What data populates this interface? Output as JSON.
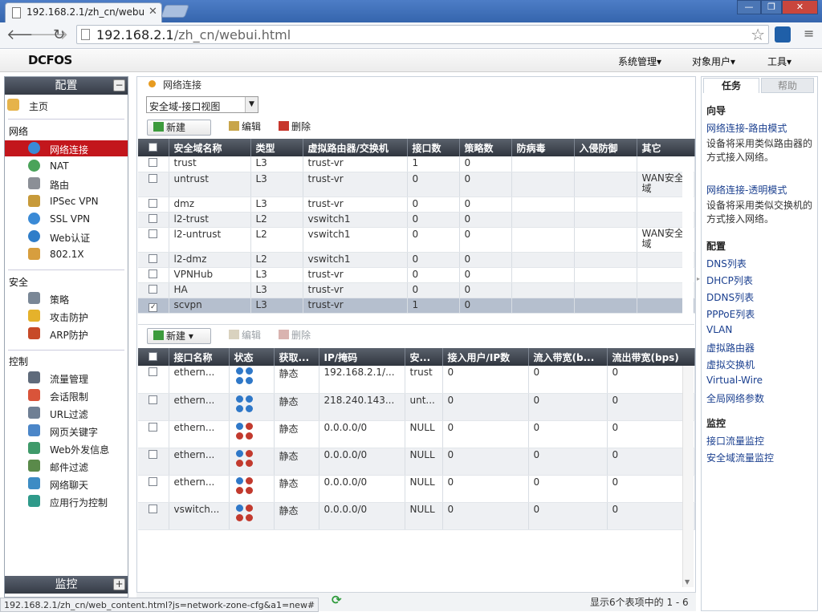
{
  "browser": {
    "tab_title": "192.168.2.1/zh_cn/webu",
    "url_host": "192.168.2.1",
    "url_path": "/zh_cn/webui.html",
    "status_url": "192.168.2.1/zh_cn/web_content.html?js=network-zone-cfg&a1=new#"
  },
  "app": {
    "logo": "DCFOS",
    "menus": [
      "系统管理",
      "对象用户",
      "工具"
    ]
  },
  "sidebar": {
    "config_title": "配置",
    "monitor_title": "监控",
    "home": "主页",
    "groups": {
      "network": "网络",
      "security": "安全",
      "control": "控制"
    },
    "network_items": [
      "网络连接",
      "NAT",
      "路由",
      "IPSec VPN",
      "SSL VPN",
      "Web认证",
      "802.1X"
    ],
    "security_items": [
      "策略",
      "攻击防护",
      "ARP防护"
    ],
    "control_items": [
      "流量管理",
      "会话限制",
      "URL过滤",
      "网页关键字",
      "Web外发信息",
      "邮件过滤",
      "网络聊天",
      "应用行为控制"
    ],
    "selected": "网络连接"
  },
  "main": {
    "breadcrumb": "网络连接",
    "view_select": "安全域-接口视图",
    "zone_toolbar": {
      "new": "新建",
      "edit": "编辑",
      "delete": "删除"
    },
    "zone_columns": [
      "安全域名称",
      "类型",
      "虚拟路由器/交换机",
      "接口数",
      "策略数",
      "防病毒",
      "入侵防御",
      "其它"
    ],
    "zones": [
      {
        "name": "trust",
        "type": "L3",
        "vr": "trust-vr",
        "ifaces": "1",
        "policies": "0",
        "av": "",
        "ips": "",
        "other": "",
        "checked": false
      },
      {
        "name": "untrust",
        "type": "L3",
        "vr": "trust-vr",
        "ifaces": "0",
        "policies": "0",
        "av": "",
        "ips": "",
        "other": "WAN安全域",
        "checked": false
      },
      {
        "name": "dmz",
        "type": "L3",
        "vr": "trust-vr",
        "ifaces": "0",
        "policies": "0",
        "av": "",
        "ips": "",
        "other": "",
        "checked": false
      },
      {
        "name": "l2-trust",
        "type": "L2",
        "vr": "vswitch1",
        "ifaces": "0",
        "policies": "0",
        "av": "",
        "ips": "",
        "other": "",
        "checked": false
      },
      {
        "name": "l2-untrust",
        "type": "L2",
        "vr": "vswitch1",
        "ifaces": "0",
        "policies": "0",
        "av": "",
        "ips": "",
        "other": "WAN安全域",
        "checked": false
      },
      {
        "name": "l2-dmz",
        "type": "L2",
        "vr": "vswitch1",
        "ifaces": "0",
        "policies": "0",
        "av": "",
        "ips": "",
        "other": "",
        "checked": false
      },
      {
        "name": "VPNHub",
        "type": "L3",
        "vr": "trust-vr",
        "ifaces": "0",
        "policies": "0",
        "av": "",
        "ips": "",
        "other": "",
        "checked": false
      },
      {
        "name": "HA",
        "type": "L3",
        "vr": "trust-vr",
        "ifaces": "0",
        "policies": "0",
        "av": "",
        "ips": "",
        "other": "",
        "checked": false
      },
      {
        "name": "scvpn",
        "type": "L3",
        "vr": "trust-vr",
        "ifaces": "1",
        "policies": "0",
        "av": "",
        "ips": "",
        "other": "",
        "checked": true
      }
    ],
    "iface_toolbar": {
      "new": "新建",
      "edit": "编辑",
      "delete": "删除"
    },
    "iface_columns": [
      "接口名称",
      "状态",
      "获取...",
      "IP/掩码",
      "安...",
      "接入用户/IP数",
      "流入带宽(b...",
      "流出带宽(bps)"
    ],
    "ifaces": [
      {
        "name": "ethern...",
        "mode": "静态",
        "ip": "192.168.2.1/...",
        "zone": "trust",
        "users": "0",
        "in": "0",
        "out": "0"
      },
      {
        "name": "ethern...",
        "mode": "静态",
        "ip": "218.240.143...",
        "zone": "unt...",
        "users": "0",
        "in": "0",
        "out": "0"
      },
      {
        "name": "ethern...",
        "mode": "静态",
        "ip": "0.0.0.0/0",
        "zone": "NULL",
        "users": "0",
        "in": "0",
        "out": "0"
      },
      {
        "name": "ethern...",
        "mode": "静态",
        "ip": "0.0.0.0/0",
        "zone": "NULL",
        "users": "0",
        "in": "0",
        "out": "0"
      },
      {
        "name": "ethern...",
        "mode": "静态",
        "ip": "0.0.0.0/0",
        "zone": "NULL",
        "users": "0",
        "in": "0",
        "out": "0"
      },
      {
        "name": "vswitch...",
        "mode": "静态",
        "ip": "0.0.0.0/0",
        "zone": "NULL",
        "users": "0",
        "in": "0",
        "out": "0"
      }
    ],
    "pager_text": "显示6个表项中的 1 - 6"
  },
  "right": {
    "tabs": [
      "任务",
      "帮助"
    ],
    "guide_title": "向导",
    "guide": [
      {
        "link": "网络连接-路由模式",
        "desc": "设备将采用类似路由器的方式接入网络。"
      },
      {
        "link": "网络连接-透明模式",
        "desc": "设备将采用类似交换机的方式接入网络。"
      }
    ],
    "config_title": "配置",
    "config_links": [
      "DNS列表",
      "DHCP列表",
      "DDNS列表",
      "PPPoE列表",
      "VLAN",
      "虚拟路由器",
      "虚拟交换机",
      "Virtual-Wire",
      "全局网络参数"
    ],
    "monitor_title": "监控",
    "monitor_links": [
      "接口流量监控",
      "安全域流量监控"
    ]
  },
  "colors": {
    "selected_nav": "#c3161c",
    "header_dark": "#353b45",
    "link_blue": "#1a3f8f",
    "breadcrumb_dot": "#e79b20"
  }
}
